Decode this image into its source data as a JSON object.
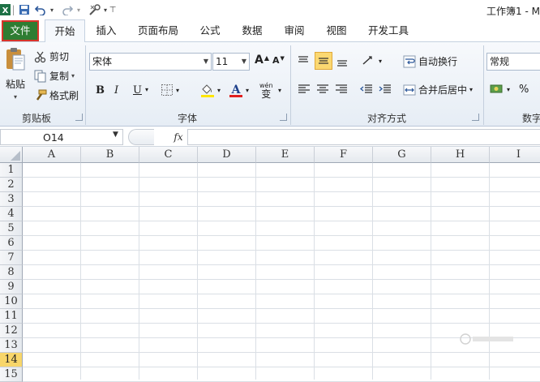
{
  "title_bar": {
    "doc_title": "工作簿1 - M",
    "icons": [
      "excel-logo-icon",
      "save-icon",
      "undo-icon",
      "redo-icon",
      "customize-icon"
    ]
  },
  "tabs": [
    "文件",
    "开始",
    "插入",
    "页面布局",
    "公式",
    "数据",
    "审阅",
    "视图",
    "开发工具"
  ],
  "ribbon": {
    "clipboard": {
      "paste": "粘贴",
      "cut": "剪切",
      "copy": "复制",
      "format_painter": "格式刷",
      "label": "剪贴板"
    },
    "font": {
      "font_name": "宋体",
      "font_size": "11",
      "grow": "A",
      "shrink": "A",
      "bold": "B",
      "italic": "I",
      "underline": "U",
      "phonetic": "wén",
      "phonetic_char": "变",
      "label": "字体"
    },
    "alignment": {
      "wrap_text": "自动换行",
      "merge_center": "合并后居中",
      "label": "对齐方式"
    },
    "number": {
      "format": "常规",
      "percent": "%",
      "label": "数字"
    }
  },
  "formula_bar": {
    "name_box": "O14",
    "fx": "fx",
    "formula": ""
  },
  "columns": [
    "A",
    "B",
    "C",
    "D",
    "E",
    "F",
    "G",
    "H",
    "I"
  ],
  "rows": [
    "1",
    "2",
    "3",
    "4",
    "5",
    "6",
    "7",
    "8",
    "9",
    "10",
    "11",
    "12",
    "13",
    "14",
    "15"
  ],
  "selected_row": "14",
  "colors": {
    "file_tab": "#2e7d32",
    "file_tab_outline": "#d9342b",
    "selected_row_header": "#f8d66a"
  }
}
